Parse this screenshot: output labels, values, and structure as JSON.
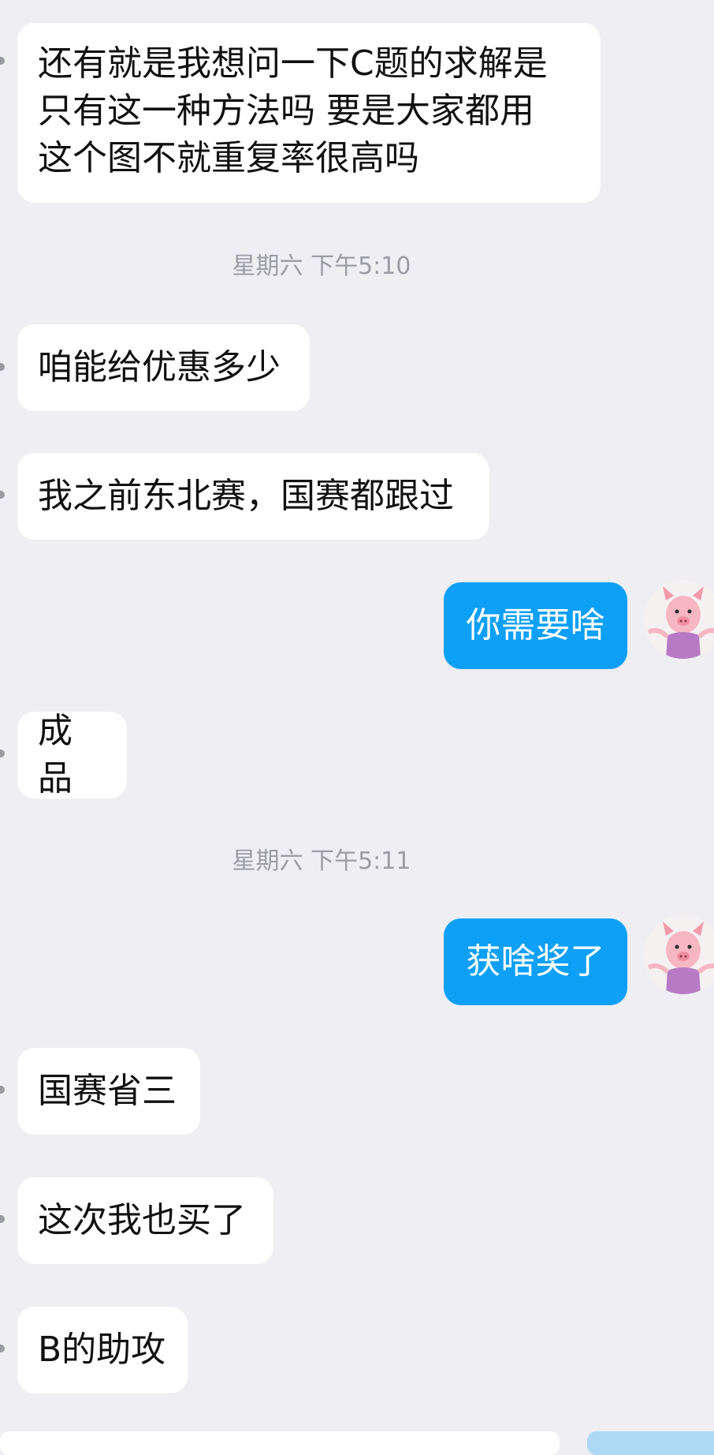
{
  "messages": [
    {
      "text": "还有就是我想问一下C题的求解是\n只有这一种方法吗 要是大家都用\n这个图不就重复率很高吗"
    },
    {
      "text": "咱能给优惠多少"
    },
    {
      "text": "我之前东北赛，国赛都跟过"
    },
    {
      "text": "你需要啥"
    },
    {
      "text": "成品"
    },
    {
      "text": "获啥奖了"
    },
    {
      "text": "国赛省三"
    },
    {
      "text": "这次我也买了"
    },
    {
      "text": "B的助攻"
    }
  ],
  "timestamps": [
    "星期六 下午5:10",
    "星期六 下午5:11"
  ],
  "colors": {
    "background": "#eeeef3",
    "incoming_bubble": "#ffffff",
    "outgoing_bubble": "#0ea0f6",
    "timestamp_text": "#9c9ca4"
  },
  "avatar": {
    "icon": "piglet-avatar-icon"
  }
}
